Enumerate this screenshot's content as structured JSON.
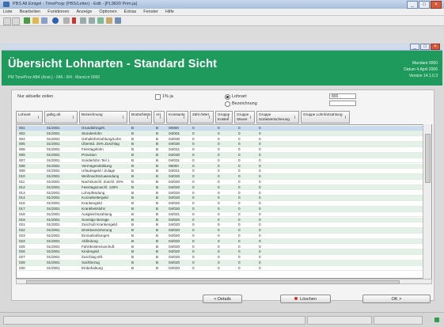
{
  "window": {
    "title": "PBS All Einigel - TimeProjz (PBS/Leiter) - Edit - [PL9820 Prim.ja]"
  },
  "menubar": [
    "Liste",
    "Bearbeiten",
    "Funktionen",
    "Anzeige",
    "Optionen",
    "Extras",
    "Fenster",
    "Hilfe"
  ],
  "header": {
    "title": "Übersicht Lohnarten  -  Standard Sicht",
    "subtitle": "PM TimeProz AB4 (Anst.) · 046 - 8/4 · Mand.nr 0060",
    "meta": [
      "Mandant  0060",
      "Datum   4.April 2006",
      "Version  14.1.0.3"
    ]
  },
  "filter": {
    "show_all_label": "Nur aktuelle zeilen",
    "checkbox_label": "1% ja",
    "radio_1": "Lohnart",
    "radio_2": "Bezeichnung",
    "search_value": "800"
  },
  "columns": [
    "Lohnart",
    "gültig ab",
    "Bezeichnung",
    "Brutto/Netto",
    "Art",
    "Konstante",
    "Zähl./Wert",
    "Gruppe Kosten",
    "Gruppe Steuer",
    "Gruppe Sozialversicherung",
    "Gruppe Lohnfortzahlung"
  ],
  "rows": [
    [
      "001",
      "01/2001",
      "Grundlohngeh.",
      "B",
      "B",
      "00000",
      "0",
      "0",
      "0",
      "0"
    ],
    [
      "002",
      "01/2001",
      "Stundenlohn",
      "B",
      "B",
      "04/001",
      "0",
      "0",
      "0",
      "0"
    ],
    [
      "004",
      "01/2001",
      "Gehaltsfortzahlung/Lohn",
      "B",
      "B",
      "04/030",
      "0",
      "0",
      "0",
      "0"
    ],
    [
      "005",
      "01/2001",
      "Überstd. 25% Zuschlag",
      "B",
      "B",
      "04/030",
      "0",
      "0",
      "0",
      "0"
    ],
    [
      "006",
      "01/2001",
      "Feiertagslohn",
      "B",
      "B",
      "04/021",
      "0",
      "0",
      "0",
      "0"
    ],
    [
      "006",
      "01/2001",
      "Provision",
      "B",
      "B",
      "04/030",
      "0",
      "0",
      "0",
      "0"
    ],
    [
      "007",
      "01/2001",
      "Sonderlohn Teil 1",
      "B",
      "B",
      "04/031",
      "0",
      "0",
      "0",
      "0"
    ],
    [
      "008",
      "01/2001",
      "Vermögensbildung",
      "B",
      "B",
      "08000",
      "0",
      "0",
      "0",
      "0"
    ],
    [
      "009",
      "01/2001",
      "Urlaubsgeld / Zulage",
      "B",
      "B",
      "04/021",
      "0",
      "0",
      "0",
      "0"
    ],
    [
      "010",
      "01/2001",
      "Weihnachtszuwendung",
      "B",
      "B",
      "04/020",
      "0",
      "0",
      "0",
      "0"
    ],
    [
      "011",
      "01/2001",
      "Nachtzuschl. Zuschl. 25%",
      "B",
      "B",
      "04/020",
      "0",
      "0",
      "0",
      "0"
    ],
    [
      "012",
      "01/2001",
      "Feiertagszuschl. 125%",
      "B",
      "B",
      "04/020",
      "0",
      "0",
      "0",
      "0"
    ],
    [
      "013",
      "01/2001",
      "Lohnpfändung",
      "B",
      "B",
      "04/020",
      "0",
      "0",
      "0",
      "0"
    ],
    [
      "014",
      "01/2001",
      "Kurzarbeitergeld",
      "B",
      "B",
      "04/020",
      "0",
      "0",
      "0",
      "0"
    ],
    [
      "016",
      "01/2001",
      "Krankengeld",
      "B",
      "B",
      "04/020",
      "0",
      "0",
      "0",
      "0"
    ],
    [
      "017",
      "01/2001",
      "Krankheitslohn",
      "B",
      "B",
      "04/020",
      "0",
      "0",
      "0",
      "0"
    ],
    [
      "018",
      "01/2001",
      "Ausgleichszahlung",
      "B",
      "B",
      "04/021",
      "0",
      "0",
      "0",
      "0"
    ],
    [
      "019",
      "01/2001",
      "Sonstige Bezüge",
      "B",
      "B",
      "04/020",
      "0",
      "0",
      "0",
      "0"
    ],
    [
      "021",
      "01/2001",
      "Zuschuß Krankengeld",
      "B",
      "B",
      "04/020",
      "0",
      "0",
      "0",
      "0"
    ],
    [
      "022",
      "01/2001",
      "Direktversicherung",
      "B",
      "B",
      "04/020",
      "0",
      "0",
      "0",
      "0"
    ],
    [
      "023",
      "01/2001",
      "Einmalzahlungen",
      "B",
      "B",
      "04/020",
      "0",
      "0",
      "0",
      "0"
    ],
    [
      "024",
      "01/2001",
      "Abfindung",
      "B",
      "B",
      "04/020",
      "0",
      "0",
      "0",
      "0"
    ],
    [
      "025",
      "01/2001",
      "Fahrtkostenzuschuß",
      "B",
      "B",
      "04/020",
      "0",
      "0",
      "0",
      "0"
    ],
    [
      "026",
      "01/2001",
      "Kindergeld",
      "B",
      "B",
      "04/020",
      "0",
      "0",
      "0",
      "0"
    ],
    [
      "027",
      "01/2001",
      "Zuschlag stfr.",
      "B",
      "B",
      "04/020",
      "0",
      "0",
      "0",
      "0"
    ],
    [
      "028",
      "01/2001",
      "Sachbezug",
      "B",
      "B",
      "04/020",
      "0",
      "0",
      "0",
      "0"
    ],
    [
      "030",
      "01/2001",
      "Einbehaltung",
      "B",
      "B",
      "04/020",
      "0",
      "0",
      "0",
      "0"
    ]
  ],
  "buttons": {
    "detail": "< Details",
    "delete": "Löschen",
    "ok": "OK >"
  }
}
